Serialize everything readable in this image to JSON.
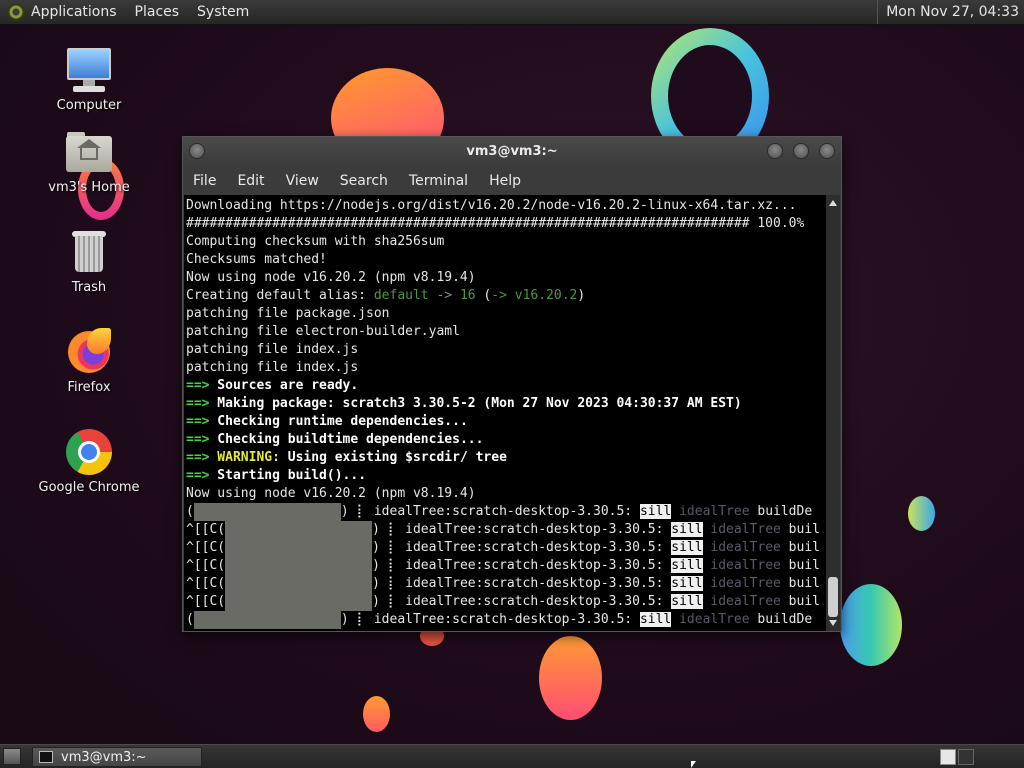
{
  "top_panel": {
    "menus": [
      "Applications",
      "Places",
      "System"
    ],
    "clock": "Mon Nov 27, 04:33"
  },
  "desktop_icons": [
    {
      "label": "Computer",
      "icon": "computer-icon"
    },
    {
      "label": "vm3's Home",
      "icon": "home-folder-icon"
    },
    {
      "label": "Trash",
      "icon": "trash-icon"
    },
    {
      "label": "Firefox",
      "icon": "firefox-icon"
    },
    {
      "label": "Google Chrome",
      "icon": "chrome-icon"
    }
  ],
  "window": {
    "title": "vm3@vm3:~",
    "menus": [
      "File",
      "Edit",
      "View",
      "Search",
      "Terminal",
      "Help"
    ]
  },
  "terminal": {
    "l1": "Downloading https://nodejs.org/dist/v16.20.2/node-v16.20.2-linux-x64.tar.xz...",
    "l2": "######################################################################## 100.0%",
    "l3": "Computing checksum with sha256sum",
    "l4": "Checksums matched!",
    "l5": "Now using node v16.20.2 (npm v8.19.4)",
    "l6a": "Creating default alias: ",
    "l6b": "default",
    "l6c": " -> ",
    "l6d": "16",
    "l6e": " (",
    "l6f": "-> v16.20.2",
    "l6g": ")",
    "l7": "patching file package.json",
    "l8": "patching file electron-builder.yaml",
    "l9": "patching file index.js",
    "l10": "patching file index.js",
    "arrow": "==>",
    "m1": " Sources are ready.",
    "m2": " Making package: scratch3 3.30.5-2 (Mon 27 Nov 2023 04:30:37 AM EST)",
    "m3": " Checking runtime dependencies...",
    "m4": " Checking buildtime dependencies...",
    "warn": " WARNING:",
    "m5": " Using existing $srcdir/ tree",
    "m6": " Starting build()...",
    "l11": "Now using node v16.20.2 (npm v8.19.4)",
    "open_paren": "(",
    "ctrl_c": "^[[C(",
    "close_spin": ") ",
    "spinner": "⡇",
    "idealtree_prefix": " idealTree:scratch-desktop-3.30.5: ",
    "sill": "sill",
    "idealtree_word": " idealTree",
    "buildde": " buildDe",
    "buil": " buil"
  },
  "taskbar": {
    "window_label": "vm3@vm3:~"
  }
}
